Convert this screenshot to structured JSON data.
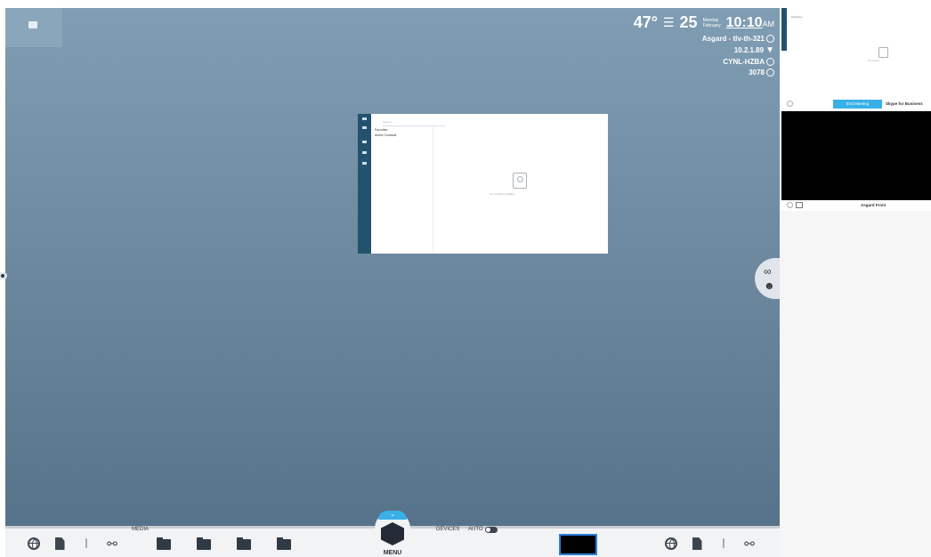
{
  "status": {
    "temperature": "47°",
    "weather_icon": "menu-lines-icon",
    "day": "25",
    "weekday": "Monday",
    "month": "February",
    "time": "10:10",
    "ampm": "AM",
    "room": "Asgard - tlv-th-321",
    "ip": "10.2.1.89",
    "code": "CYNL-HZBA",
    "ext": "3078"
  },
  "window": {
    "search_placeholder": "Search...",
    "labels": [
      "Favorites",
      "Active Contacts"
    ],
    "empty_text": "No contacts available"
  },
  "dock": {
    "media_label": "MEDIA",
    "devices_label": "DEVICES",
    "auto_label": "AUTO",
    "menu_label": "MENU",
    "left_icons": [
      "globe-icon",
      "document-icon",
      "audio-wave-icon",
      "network-icon"
    ],
    "folders": 4,
    "right_icons": [
      "globe-icon",
      "document-icon",
      "audio-wave-icon",
      "network-icon"
    ]
  },
  "side": {
    "mini_note": "Favorites",
    "mini_empty": "No contacts",
    "end_meeting": "End Meeting",
    "skype": "Skype for Business",
    "camera_name": "Asgard Front"
  }
}
